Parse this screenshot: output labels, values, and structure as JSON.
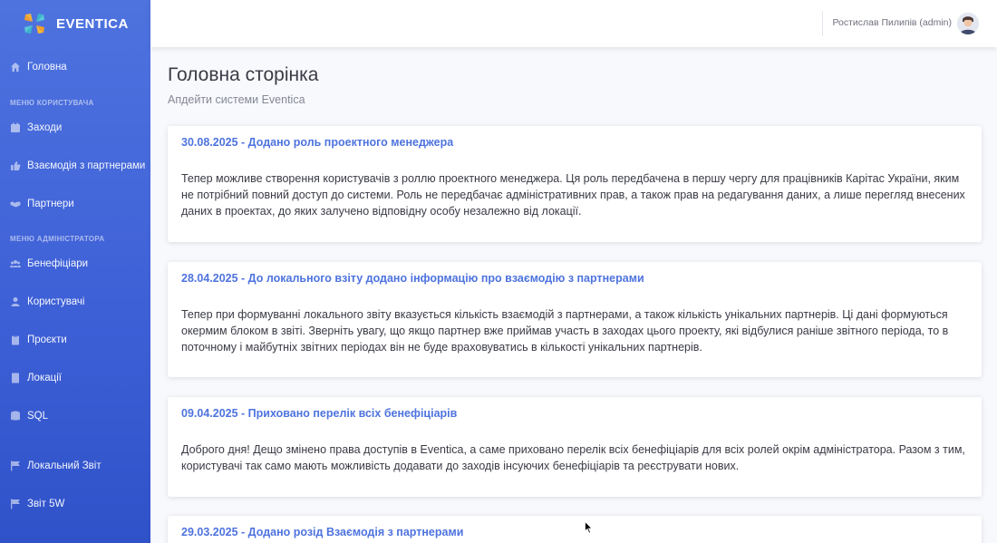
{
  "brand": {
    "name": "EVENTICA"
  },
  "sidebar": {
    "home": {
      "label": "Головна",
      "icon": "home-icon"
    },
    "user_menu_heading": "Меню користувача",
    "user_items": [
      {
        "label": "Заходи",
        "icon": "calendar-icon"
      },
      {
        "label": "Взаємодія з партнерами",
        "icon": "thumbs-up-icon"
      },
      {
        "label": "Партнери",
        "icon": "handshake-icon"
      }
    ],
    "admin_menu_heading": "Меню адміністратора",
    "admin_items": [
      {
        "label": "Бенефіціари",
        "icon": "users-icon"
      },
      {
        "label": "Користувачі",
        "icon": "user-icon"
      },
      {
        "label": "Проєкти",
        "icon": "clipboard-icon"
      },
      {
        "label": "Локації",
        "icon": "building-icon"
      },
      {
        "label": "SQL",
        "icon": "database-icon"
      }
    ],
    "report_items": [
      {
        "label": "Локальний Звіт",
        "icon": "flag-icon"
      },
      {
        "label": "Звіт 5W",
        "icon": "flag-icon"
      }
    ]
  },
  "topbar": {
    "user_name": "Ростислав Пилипів (admin)"
  },
  "main": {
    "title": "Головна сторінка",
    "subtitle": "Апдейти системи Eventica",
    "updates": [
      {
        "title": "30.08.2025 - Додано роль проектного менеджера",
        "body": "Тепер можливе створення користувачів з роллю проектного менеджера. Ця роль передбачена в першу чергу для працівників Карітас України, яким не потрібний повний доступ до системи. Роль не передбачає адміністративних прав, а також прав на редагування даних, а лише перегляд внесених даних в проектах, до яких залучено відповідну особу незалежно від локації."
      },
      {
        "title": "28.04.2025 - До локального взіту додано інформацію про взаємодію з партнерами",
        "body": "Тепер при формуванні локального звіту вказується кількість взаємодій з партнерами, а також кількість унікальних партнерів. Ці дані формуються окермим блоком в звіті. Зверніть увагу, що якщо партнер вже приймав участь в заходах цього проекту, які відбулися раніше звітного періода, то в поточному і майбутніх звітних періодах він не буде враховуватись в кількості унікальних партнерів."
      },
      {
        "title": "09.04.2025 - Приховано перелік всіх бенефіціарів",
        "body": "Доброго дня! Дещо змінено права доступів в Eventica, а саме приховано перелік всіх бенефіціарів для всіх ролей окрім адміністратора. Разом з тим, користувачі так само мають можливість додавати до заходів інсуючих бенефіціарів та реєструвати нових."
      },
      {
        "title": "29.03.2025 - Додано розід Взаємодія з партнерами",
        "body": ""
      }
    ]
  },
  "colors": {
    "sidebar": "#4e73df",
    "accent": "#4e73df",
    "background": "#f8f9fc"
  }
}
